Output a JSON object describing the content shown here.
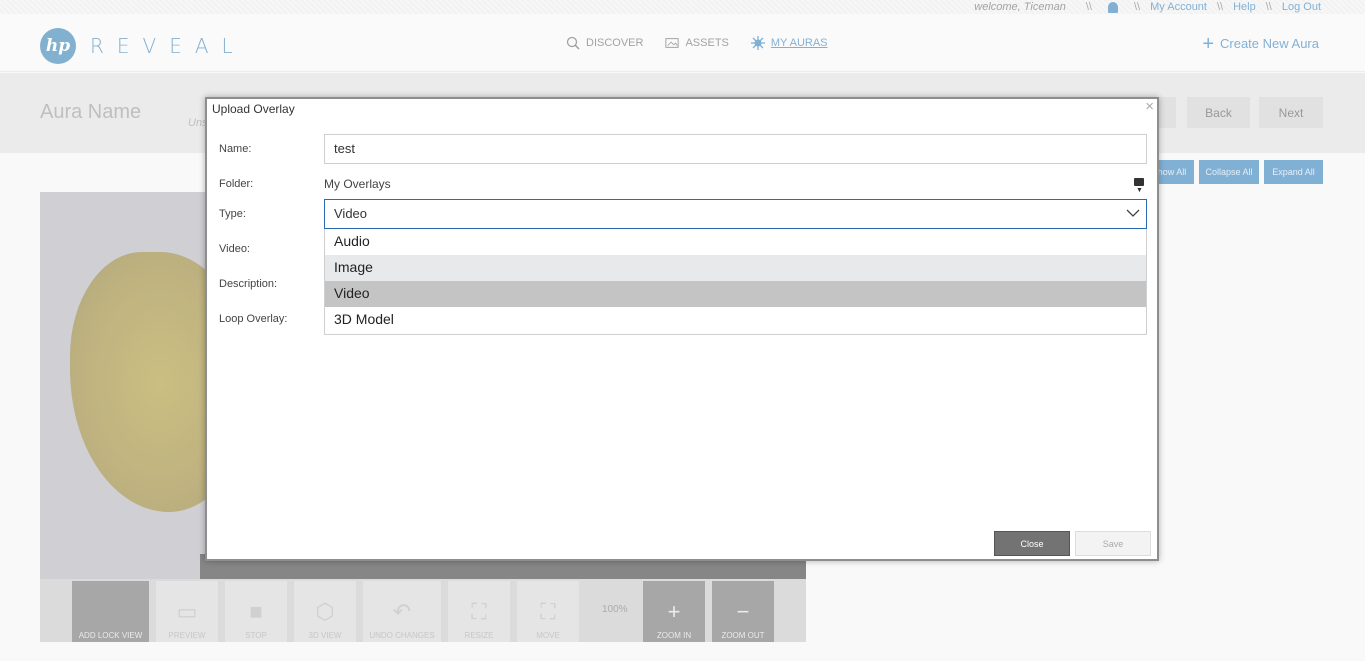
{
  "topbar": {
    "welcome": "welcome, Ticeman",
    "sep": "\\\\",
    "my_account": "My Account",
    "help": "Help",
    "logout": "Log Out"
  },
  "header": {
    "logo_text": "REVEAL",
    "logo_mark": "hp",
    "nav": [
      {
        "label": "DISCOVER",
        "icon": "search-icon"
      },
      {
        "label": "ASSETS",
        "icon": "image-icon"
      },
      {
        "label": "MY AURAS",
        "icon": "aura-icon"
      }
    ],
    "create_aura": "Create New Aura"
  },
  "subbar": {
    "aura_name": "Aura Name",
    "status": "Uns",
    "back": "Back",
    "next": "Next"
  },
  "pills": {
    "show_all": "how All",
    "collapse_all": "Collapse All",
    "expand_all": "Expand All"
  },
  "toolbar": {
    "items": [
      "ADD LOCK VIEW",
      "PREVIEW",
      "STOP",
      "3D VIEW",
      "UNDO CHANGES",
      "RESIZE",
      "MOVE",
      "ZOOM IN",
      "ZOOM OUT"
    ],
    "zoom": "100%"
  },
  "modal": {
    "title": "Upload Overlay",
    "close_glyph": "×",
    "labels": {
      "name": "Name:",
      "folder": "Folder:",
      "type": "Type:",
      "video": "Video:",
      "description": "Description:",
      "loop": "Loop Overlay:"
    },
    "name_value": "test",
    "folder_value": "My Overlays",
    "type_value": "Video",
    "type_options": [
      "Audio",
      "Image",
      "Video",
      "3D Model"
    ],
    "hovered_option": "Image",
    "selected_option": "Video",
    "close_button": "Close",
    "save_button": "Save"
  },
  "colors": {
    "accent": "#1b6fb3",
    "brand": "#1d6fa8"
  }
}
